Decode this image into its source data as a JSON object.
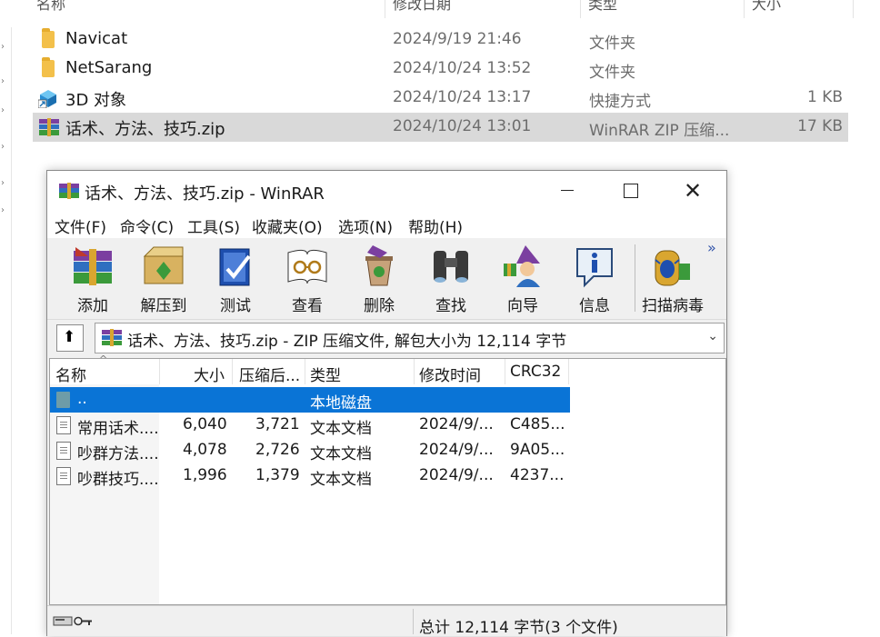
{
  "explorer": {
    "columns": [
      "名称",
      "修改日期",
      "类型",
      "大小"
    ],
    "rows": [
      {
        "name": "Navicat",
        "date": "2024/9/19 21:46",
        "type": "文件夹",
        "size": "",
        "icon": "folder-icon"
      },
      {
        "name": "NetSarang",
        "date": "2024/10/24 13:52",
        "type": "文件夹",
        "size": "",
        "icon": "folder-icon"
      },
      {
        "name": "3D 对象",
        "date": "2024/10/24 13:17",
        "type": "快捷方式",
        "size": "1 KB",
        "icon": "3d-objects-shortcut-icon"
      },
      {
        "name": "话术、方法、技巧.zip",
        "date": "2024/10/24 13:01",
        "type": "WinRAR ZIP 压缩...",
        "size": "17 KB",
        "icon": "winrar-archive-icon",
        "selected": true
      }
    ]
  },
  "winrar": {
    "title": "话术、方法、技巧.zip - WinRAR",
    "menu": [
      "文件(F)",
      "命令(C)",
      "工具(S)",
      "收藏夹(O)",
      "选项(N)",
      "帮助(H)"
    ],
    "toolbar": [
      {
        "label": "添加",
        "icon": "add-archive-icon"
      },
      {
        "label": "解压到",
        "icon": "extract-to-icon"
      },
      {
        "label": "测试",
        "icon": "test-icon"
      },
      {
        "label": "查看",
        "icon": "view-icon"
      },
      {
        "label": "删除",
        "icon": "delete-icon"
      },
      {
        "label": "查找",
        "icon": "find-icon"
      },
      {
        "label": "向导",
        "icon": "wizard-icon"
      },
      {
        "label": "信息",
        "icon": "info-icon"
      },
      {
        "label": "扫描病毒",
        "icon": "virus-scan-icon"
      }
    ],
    "toolbar_more": "»",
    "address": "话术、方法、技巧.zip - ZIP 压缩文件, 解包大小为 12,114 字节",
    "list_columns": [
      "名称",
      "大小",
      "压缩后...",
      "类型",
      "修改时间",
      "CRC32"
    ],
    "list_rows": [
      {
        "name": "..",
        "size": "",
        "packed": "",
        "type": "本地磁盘",
        "modified": "",
        "crc": "",
        "selected": true,
        "icon": "parent-folder-icon"
      },
      {
        "name": "常用话术....",
        "size": "6,040",
        "packed": "3,721",
        "type": "文本文档",
        "modified": "2024/9/...",
        "crc": "C485...",
        "icon": "text-document-icon"
      },
      {
        "name": "吵群方法....",
        "size": "4,078",
        "packed": "2,726",
        "type": "文本文档",
        "modified": "2024/9/...",
        "crc": "9A05...",
        "icon": "text-document-icon"
      },
      {
        "name": "吵群技巧....",
        "size": "1,996",
        "packed": "1,379",
        "type": "文本文档",
        "modified": "2024/9/...",
        "crc": "4237...",
        "icon": "text-document-icon"
      }
    ],
    "status": "总计 12,114 字节(3 个文件)"
  },
  "colors": {
    "selection_blue": "#0a74d6",
    "explorer_selection": "#d9d9d9",
    "folder_yellow": "#f3c04a"
  }
}
